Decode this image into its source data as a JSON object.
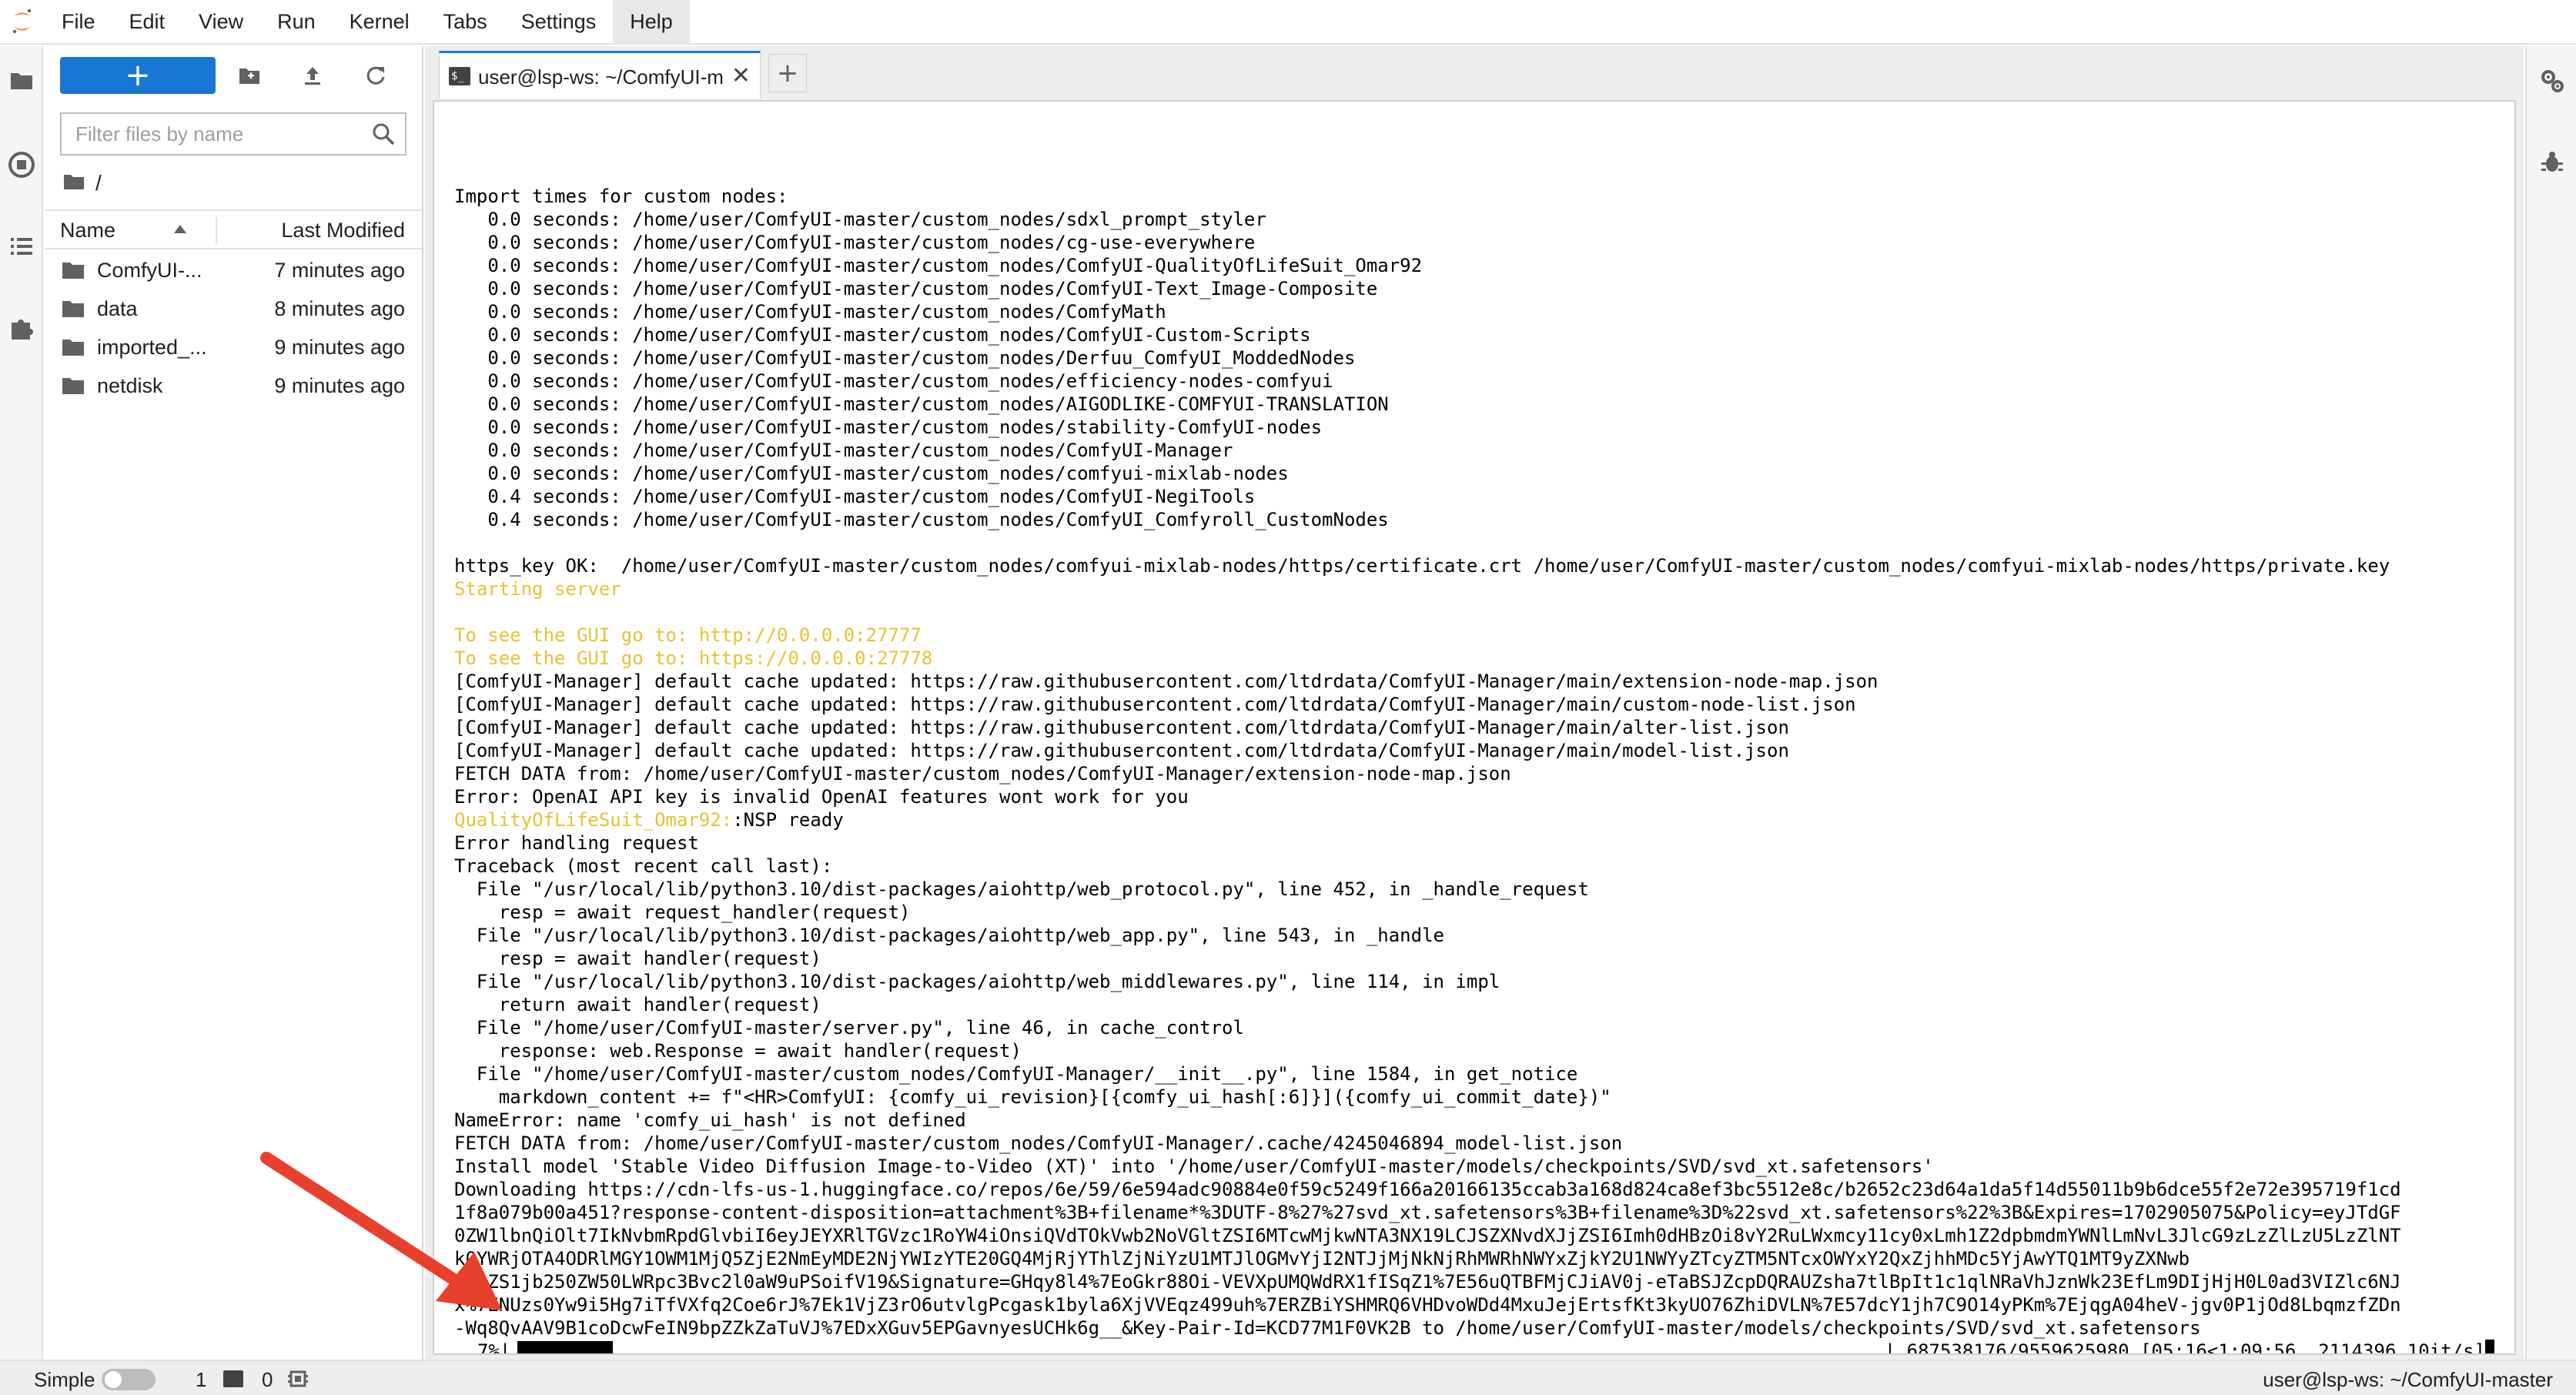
{
  "menu": [
    "File",
    "Edit",
    "View",
    "Run",
    "Kernel",
    "Tabs",
    "Settings",
    "Help"
  ],
  "menu_active_index": 7,
  "file_browser": {
    "new_label": "+",
    "filter_placeholder": "Filter files by name",
    "breadcrumb_separator": "/",
    "col_name": "Name",
    "col_modified": "Last Modified",
    "files": [
      {
        "name": "ComfyUI-...",
        "modified": "7 minutes ago"
      },
      {
        "name": "data",
        "modified": "8 minutes ago"
      },
      {
        "name": "imported_...",
        "modified": "9 minutes ago"
      },
      {
        "name": "netdisk",
        "modified": "9 minutes ago"
      }
    ]
  },
  "tab": {
    "label": "user@lsp-ws: ~/ComfyUI-m",
    "close": "✕",
    "add": "+"
  },
  "terminal": {
    "lines": [
      "Import times for custom nodes:",
      "   0.0 seconds: /home/user/ComfyUI-master/custom_nodes/sdxl_prompt_styler",
      "   0.0 seconds: /home/user/ComfyUI-master/custom_nodes/cg-use-everywhere",
      "   0.0 seconds: /home/user/ComfyUI-master/custom_nodes/ComfyUI-QualityOfLifeSuit_Omar92",
      "   0.0 seconds: /home/user/ComfyUI-master/custom_nodes/ComfyUI-Text_Image-Composite",
      "   0.0 seconds: /home/user/ComfyUI-master/custom_nodes/ComfyMath",
      "   0.0 seconds: /home/user/ComfyUI-master/custom_nodes/ComfyUI-Custom-Scripts",
      "   0.0 seconds: /home/user/ComfyUI-master/custom_nodes/Derfuu_ComfyUI_ModdedNodes",
      "   0.0 seconds: /home/user/ComfyUI-master/custom_nodes/efficiency-nodes-comfyui",
      "   0.0 seconds: /home/user/ComfyUI-master/custom_nodes/AIGODLIKE-COMFYUI-TRANSLATION",
      "   0.0 seconds: /home/user/ComfyUI-master/custom_nodes/stability-ComfyUI-nodes",
      "   0.0 seconds: /home/user/ComfyUI-master/custom_nodes/ComfyUI-Manager",
      "   0.0 seconds: /home/user/ComfyUI-master/custom_nodes/comfyui-mixlab-nodes",
      "   0.4 seconds: /home/user/ComfyUI-master/custom_nodes/ComfyUI-NegiTools",
      "   0.4 seconds: /home/user/ComfyUI-master/custom_nodes/ComfyUI_Comfyroll_CustomNodes",
      "",
      "https_key OK:  /home/user/ComfyUI-master/custom_nodes/comfyui-mixlab-nodes/https/certificate.crt /home/user/ComfyUI-master/custom_nodes/comfyui-mixlab-nodes/https/private.key",
      "Starting server",
      "",
      "To see the GUI go to: http://0.0.0.0:27777",
      "To see the GUI go to: https://0.0.0.0:27778",
      "[ComfyUI-Manager] default cache updated: https://raw.githubusercontent.com/ltdrdata/ComfyUI-Manager/main/extension-node-map.json",
      "[ComfyUI-Manager] default cache updated: https://raw.githubusercontent.com/ltdrdata/ComfyUI-Manager/main/custom-node-list.json",
      "[ComfyUI-Manager] default cache updated: https://raw.githubusercontent.com/ltdrdata/ComfyUI-Manager/main/alter-list.json",
      "[ComfyUI-Manager] default cache updated: https://raw.githubusercontent.com/ltdrdata/ComfyUI-Manager/main/model-list.json",
      "FETCH DATA from: /home/user/ComfyUI-master/custom_nodes/ComfyUI-Manager/extension-node-map.json",
      "Error: OpenAI API key is invalid OpenAI features wont work for you",
      "QualityOfLifeSuit_Omar92::NSP ready",
      "Error handling request",
      "Traceback (most recent call last):",
      "  File \"/usr/local/lib/python3.10/dist-packages/aiohttp/web_protocol.py\", line 452, in _handle_request",
      "    resp = await request_handler(request)",
      "  File \"/usr/local/lib/python3.10/dist-packages/aiohttp/web_app.py\", line 543, in _handle",
      "    resp = await handler(request)",
      "  File \"/usr/local/lib/python3.10/dist-packages/aiohttp/web_middlewares.py\", line 114, in impl",
      "    return await handler(request)",
      "  File \"/home/user/ComfyUI-master/server.py\", line 46, in cache_control",
      "    response: web.Response = await handler(request)",
      "  File \"/home/user/ComfyUI-master/custom_nodes/ComfyUI-Manager/__init__.py\", line 1584, in get_notice",
      "    markdown_content += f\"<HR>ComfyUI: {comfy_ui_revision}[{comfy_ui_hash[:6]}]({comfy_ui_commit_date})\"",
      "NameError: name 'comfy_ui_hash' is not defined",
      "FETCH DATA from: /home/user/ComfyUI-master/custom_nodes/ComfyUI-Manager/.cache/4245046894_model-list.json",
      "Install model 'Stable Video Diffusion Image-to-Video (XT)' into '/home/user/ComfyUI-master/models/checkpoints/SVD/svd_xt.safetensors'",
      "Downloading https://cdn-lfs-us-1.huggingface.co/repos/6e/59/6e594adc90884e0f59c5249f166a20166135ccab3a168d824ca8ef3bc5512e8c/b2652c23d64a1da5f14d55011b9b6dce55f2e72e395719f1cd",
      "1f8a079b00a451?response-content-disposition=attachment%3B+filename*%3DUTF-8%27%27svd_xt.safetensors%3B+filename%3D%22svd_xt.safetensors%22%3B&Expires=1702905075&Policy=eyJTdGF",
      "0ZW1lbnQiOlt7IkNvbmRpdGlvbiI6eyJEYXRlTGVzc1RoYW4iOnsiQVdTOkVwb2NoVGltZSI6MTcwMjkwNTA3NX19LCJSZXNvdXJjZSI6Imh0dHBzOi8vY2RuLWxmcy11cy0xLmh1Z2dpbmdmYWNlLmNvL3JlcG9zLzZlLzU5LzZlNT",
      "k0YWRjOTA4ODRlMGY1OWM1MjQ5ZjE2NmEyMDE2NjYWIzYTE20GQ4MjRjYThlZjNiYzU1MTJlOGMvYjI2NTJjMjNkNjRhMWRhNWYxZjkY2U1NWYyZTcyZTM5NTcxOWYxY2QxZjhhMDc5YjAwYTQ1MT9yZXNwb",
      "25zZS1jb250ZW50LWRpc3Bvc2l0aW9uPSoifV19&Signature=GHqy8l4%7EoGkr88Oi-VEVXpUMQWdRX1fISqZ1%7E56uQTBFMjCJiAV0j-eTaBSJZcpDQRAUZsha7tlBpIt1c1qlNRaVhJznWk23EfLm9DIjHjH0L0ad3VIZlc6NJ",
      "x%7ENUzs0Yw9i5Hg7iTfVXfq2Coe6rJ%7Ek1VjZ3rO6utvlgPcgask1byla6XjVVEqz499uh%7ERZBiYSHMRQ6VHDvoWDd4MxuJejErtsfKt3kyUO76ZhiDVLN%7E57dcY1jh7C9O14yPKm%7EjqgA04heV-jgv0P1jOd8LbqmzfZDn",
      "-Wq8QvAAV9B1coDcwFeIN9bpZZkZaTuVJ%7EDxXGuv5EPGavnyesUCHk6g__&Key-Pair-Id=KCD77M1F0VK2B to /home/user/ComfyUI-master/models/checkpoints/SVD/svd_xt.safetensors"
    ],
    "yellow_lines": [
      17,
      19,
      20
    ],
    "partial_yellow": {
      "line": 27,
      "text": "QualityOfLifeSuit_Omar92:",
      "rest": ":NSP ready"
    },
    "progress": {
      "percent_text": "7%|",
      "fraction": 0.07,
      "info": "| 687538176/9559625980 [05:16<1:09:56, 2114396.10it/s]"
    }
  },
  "status": {
    "mode": "Simple",
    "terminals_count": "1",
    "kernels_count": "0",
    "right_text": "user@lsp-ws: ~/ComfyUI-master"
  },
  "colors": {
    "accent": "#1976d2",
    "terminal_yellow": "#e5c332",
    "annotation_arrow": "#e8402c"
  }
}
